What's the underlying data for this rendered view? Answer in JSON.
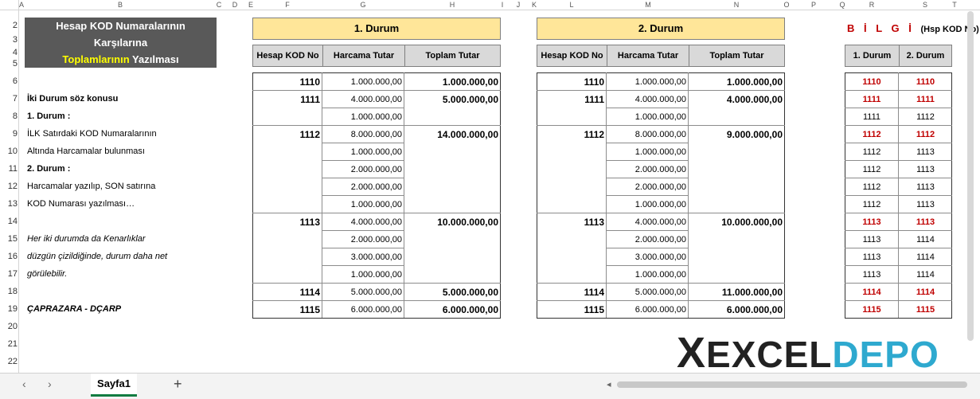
{
  "columns": [
    "A",
    "B",
    "C",
    "D",
    "E",
    "F",
    "G",
    "H",
    "I",
    "J",
    "K",
    "L",
    "M",
    "N",
    "O",
    "P",
    "Q",
    "R",
    "S",
    "T"
  ],
  "rows": [
    "2",
    "3",
    "4",
    "5",
    "6",
    "7",
    "8",
    "9",
    "10",
    "11",
    "12",
    "13",
    "14",
    "15",
    "16",
    "17",
    "18",
    "19",
    "20",
    "21",
    "22"
  ],
  "title": {
    "line1": "Hesap KOD Numaralarının",
    "line2": "Karşılarına",
    "line3a": "Toplamlarının",
    "line3b": " Yazılması"
  },
  "notes": [
    {
      "row": "7",
      "text": "İki Durum söz konusu",
      "style": "b"
    },
    {
      "row": "8",
      "text": "1. Durum :",
      "style": "b"
    },
    {
      "row": "9",
      "text": "İLK Satırdaki KOD Numaralarının",
      "style": ""
    },
    {
      "row": "10",
      "text": "Altında Harcamalar bulunması",
      "style": ""
    },
    {
      "row": "11",
      "text": "2. Durum :",
      "style": "b"
    },
    {
      "row": "12",
      "text": "Harcamalar yazılıp, SON satırına",
      "style": ""
    },
    {
      "row": "13",
      "text": "KOD Numarası yazılması…",
      "style": ""
    },
    {
      "row": "15",
      "text": "Her iki durumda da Kenarlıklar",
      "style": "i"
    },
    {
      "row": "16",
      "text": "düzgün çizildiğinde, durum daha net",
      "style": "i"
    },
    {
      "row": "17",
      "text": "görülebilir.",
      "style": "i"
    },
    {
      "row": "19",
      "text": "ÇAPRAZARA - DÇARP",
      "style": "bi"
    }
  ],
  "durum1": {
    "banner": "1. Durum",
    "headers": [
      "Hesap KOD No",
      "Harcama Tutar",
      "Toplam Tutar"
    ],
    "rows": [
      [
        "1110",
        "1.000.000,00",
        "1.000.000,00"
      ],
      [
        "1111",
        "4.000.000,00",
        "5.000.000,00"
      ],
      [
        "",
        "1.000.000,00",
        ""
      ],
      [
        "1112",
        "8.000.000,00",
        "14.000.000,00"
      ],
      [
        "",
        "1.000.000,00",
        ""
      ],
      [
        "",
        "2.000.000,00",
        ""
      ],
      [
        "",
        "2.000.000,00",
        ""
      ],
      [
        "",
        "1.000.000,00",
        ""
      ],
      [
        "1113",
        "4.000.000,00",
        "10.000.000,00"
      ],
      [
        "",
        "2.000.000,00",
        ""
      ],
      [
        "",
        "3.000.000,00",
        ""
      ],
      [
        "",
        "1.000.000,00",
        ""
      ],
      [
        "1114",
        "5.000.000,00",
        "5.000.000,00"
      ],
      [
        "1115",
        "6.000.000,00",
        "6.000.000,00"
      ]
    ]
  },
  "durum2": {
    "banner": "2. Durum",
    "headers": [
      "Hesap KOD No",
      "Harcama Tutar",
      "Toplam Tutar"
    ],
    "rows": [
      [
        "1110",
        "1.000.000,00",
        "1.000.000,00"
      ],
      [
        "1111",
        "4.000.000,00",
        "4.000.000,00"
      ],
      [
        "",
        "1.000.000,00",
        ""
      ],
      [
        "1112",
        "8.000.000,00",
        "9.000.000,00"
      ],
      [
        "",
        "1.000.000,00",
        ""
      ],
      [
        "",
        "2.000.000,00",
        ""
      ],
      [
        "",
        "2.000.000,00",
        ""
      ],
      [
        "",
        "1.000.000,00",
        ""
      ],
      [
        "1113",
        "4.000.000,00",
        "10.000.000,00"
      ],
      [
        "",
        "2.000.000,00",
        ""
      ],
      [
        "",
        "3.000.000,00",
        ""
      ],
      [
        "",
        "1.000.000,00",
        ""
      ],
      [
        "1114",
        "5.000.000,00",
        "11.000.000,00"
      ],
      [
        "1115",
        "6.000.000,00",
        "6.000.000,00"
      ]
    ]
  },
  "bilgi": {
    "title": "B İ L G İ",
    "subtitle": "(Hsp KOD No)",
    "headers": [
      "1. Durum",
      "2. Durum"
    ],
    "rows": [
      [
        "1110",
        "1110",
        true
      ],
      [
        "1111",
        "1111",
        true
      ],
      [
        "1111",
        "1112",
        false
      ],
      [
        "1112",
        "1112",
        true
      ],
      [
        "1112",
        "1113",
        false
      ],
      [
        "1112",
        "1113",
        false
      ],
      [
        "1112",
        "1113",
        false
      ],
      [
        "1112",
        "1113",
        false
      ],
      [
        "1113",
        "1113",
        true
      ],
      [
        "1113",
        "1114",
        false
      ],
      [
        "1113",
        "1114",
        false
      ],
      [
        "1113",
        "1114",
        false
      ],
      [
        "1114",
        "1114",
        true
      ],
      [
        "1115",
        "1115",
        true
      ]
    ]
  },
  "sheet_tab": "Sayfa1",
  "logo": {
    "x": "X",
    "excel": "EXCEL",
    "depo": "DEPO"
  },
  "colors": {
    "banner": "#ffe699",
    "header": "#d9d9d9",
    "red": "#c00000",
    "title_bg": "#595959",
    "logo_blue": "#2ea9cf"
  }
}
